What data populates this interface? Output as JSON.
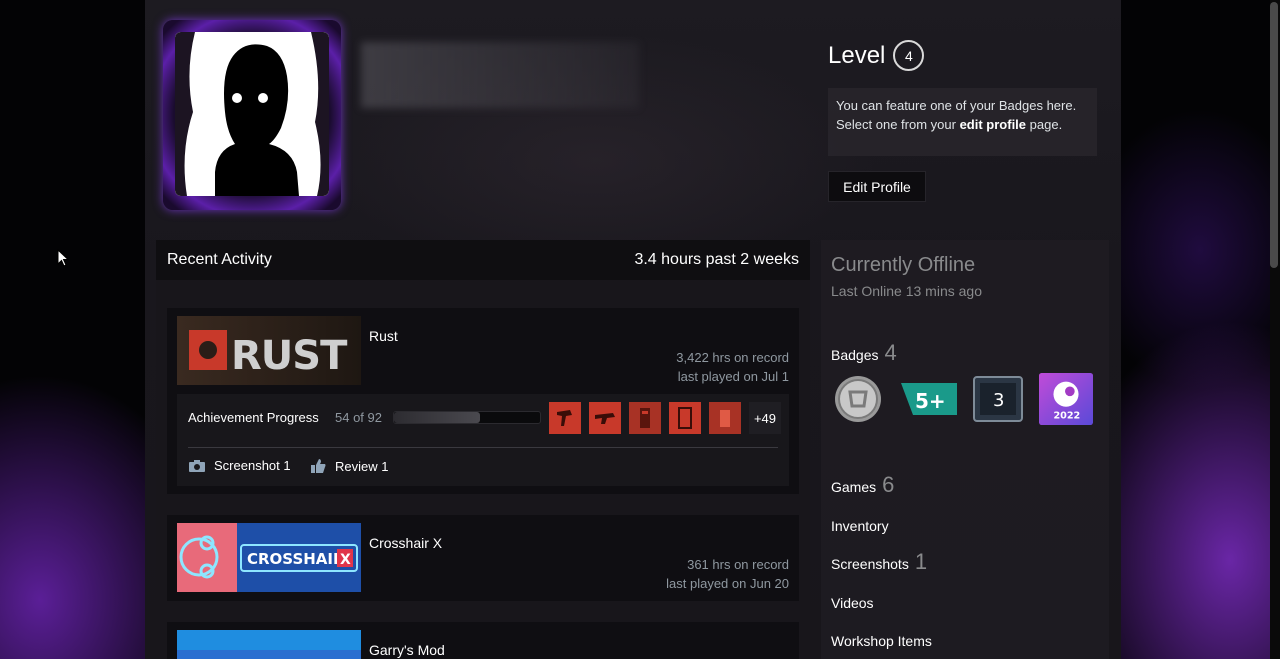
{
  "profile": {
    "level_label": "Level",
    "level_value": "4",
    "feature_text_1": "You can feature one of your Badges here.",
    "feature_text_2": "Select one from your",
    "feature_link": "edit profile",
    "feature_text_3": "page.",
    "edit_button": "Edit Profile"
  },
  "activity": {
    "title": "Recent Activity",
    "hours": "3.4 hours past 2 weeks",
    "games": [
      {
        "name": "Rust",
        "hrs_on_record": "3,422 hrs on record",
        "last_played": "last played on Jul 1",
        "achievement_label": "Achievement Progress",
        "achievement_count": "54 of 92",
        "achievement_progress": 0.587,
        "more_achievements": "+49",
        "screenshot_label": "Screenshot 1",
        "review_label": "Review 1"
      },
      {
        "name": "Crosshair X",
        "hrs_on_record": "361 hrs on record",
        "last_played": "last played on Jun 20"
      },
      {
        "name": "Garry's Mod"
      }
    ]
  },
  "status": {
    "title": "Currently Offline",
    "subtitle": "Last Online 13 mins ago"
  },
  "sidebar": {
    "badges_label": "Badges",
    "badges_count": "4",
    "badge_3_text": "3",
    "badge_2_text": "5+",
    "badge_4_year": "2022",
    "games_label": "Games",
    "games_count": "6",
    "inventory_label": "Inventory",
    "screenshots_label": "Screenshots",
    "screenshots_count": "1",
    "videos_label": "Videos",
    "workshop_label": "Workshop Items"
  },
  "colors": {
    "rust_red": "#c8392a",
    "crosshair_blue": "#1e4fa8",
    "accent_purple": "#5b1fa8"
  }
}
